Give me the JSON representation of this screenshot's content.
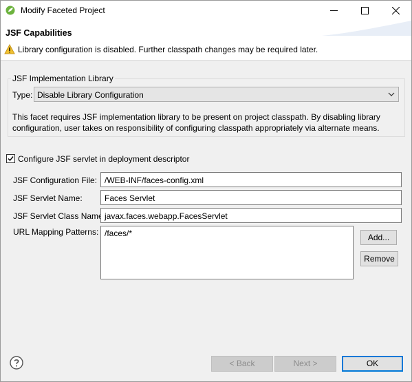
{
  "window": {
    "title": "Modify Faceted Project"
  },
  "banner": {
    "page_title": "JSF Capabilities",
    "warning": "Library configuration is disabled. Further classpath changes may be required later."
  },
  "library_group": {
    "legend": "JSF Implementation Library",
    "type_label": "Type:",
    "type_value": "Disable Library Configuration",
    "description": "This facet requires JSF implementation library to be present on project classpath. By disabling library configuration, user takes on responsibility of configuring classpath appropriately via alternate means."
  },
  "servlet": {
    "checkbox_label": "Configure JSF servlet in deployment descriptor",
    "checked": true,
    "config_file_label": "JSF Configuration File:",
    "config_file_value": "/WEB-INF/faces-config.xml",
    "servlet_name_label": "JSF Servlet Name:",
    "servlet_name_value": "Faces Servlet",
    "servlet_class_label": "JSF Servlet Class Name:",
    "servlet_class_value": "javax.faces.webapp.FacesServlet",
    "url_patterns_label": "URL Mapping Patterns:",
    "url_patterns": [
      "/faces/*"
    ],
    "add_label": "Add...",
    "remove_label": "Remove"
  },
  "footer": {
    "back_label": "< Back",
    "next_label": "Next >",
    "ok_label": "OK"
  },
  "icons": {
    "app": "eclipse-spring-icon",
    "warning": "warning-icon",
    "help": "help-icon"
  },
  "colors": {
    "accent": "#0078d7",
    "warning": "#f2c230",
    "app_icon": "#6db33f"
  }
}
